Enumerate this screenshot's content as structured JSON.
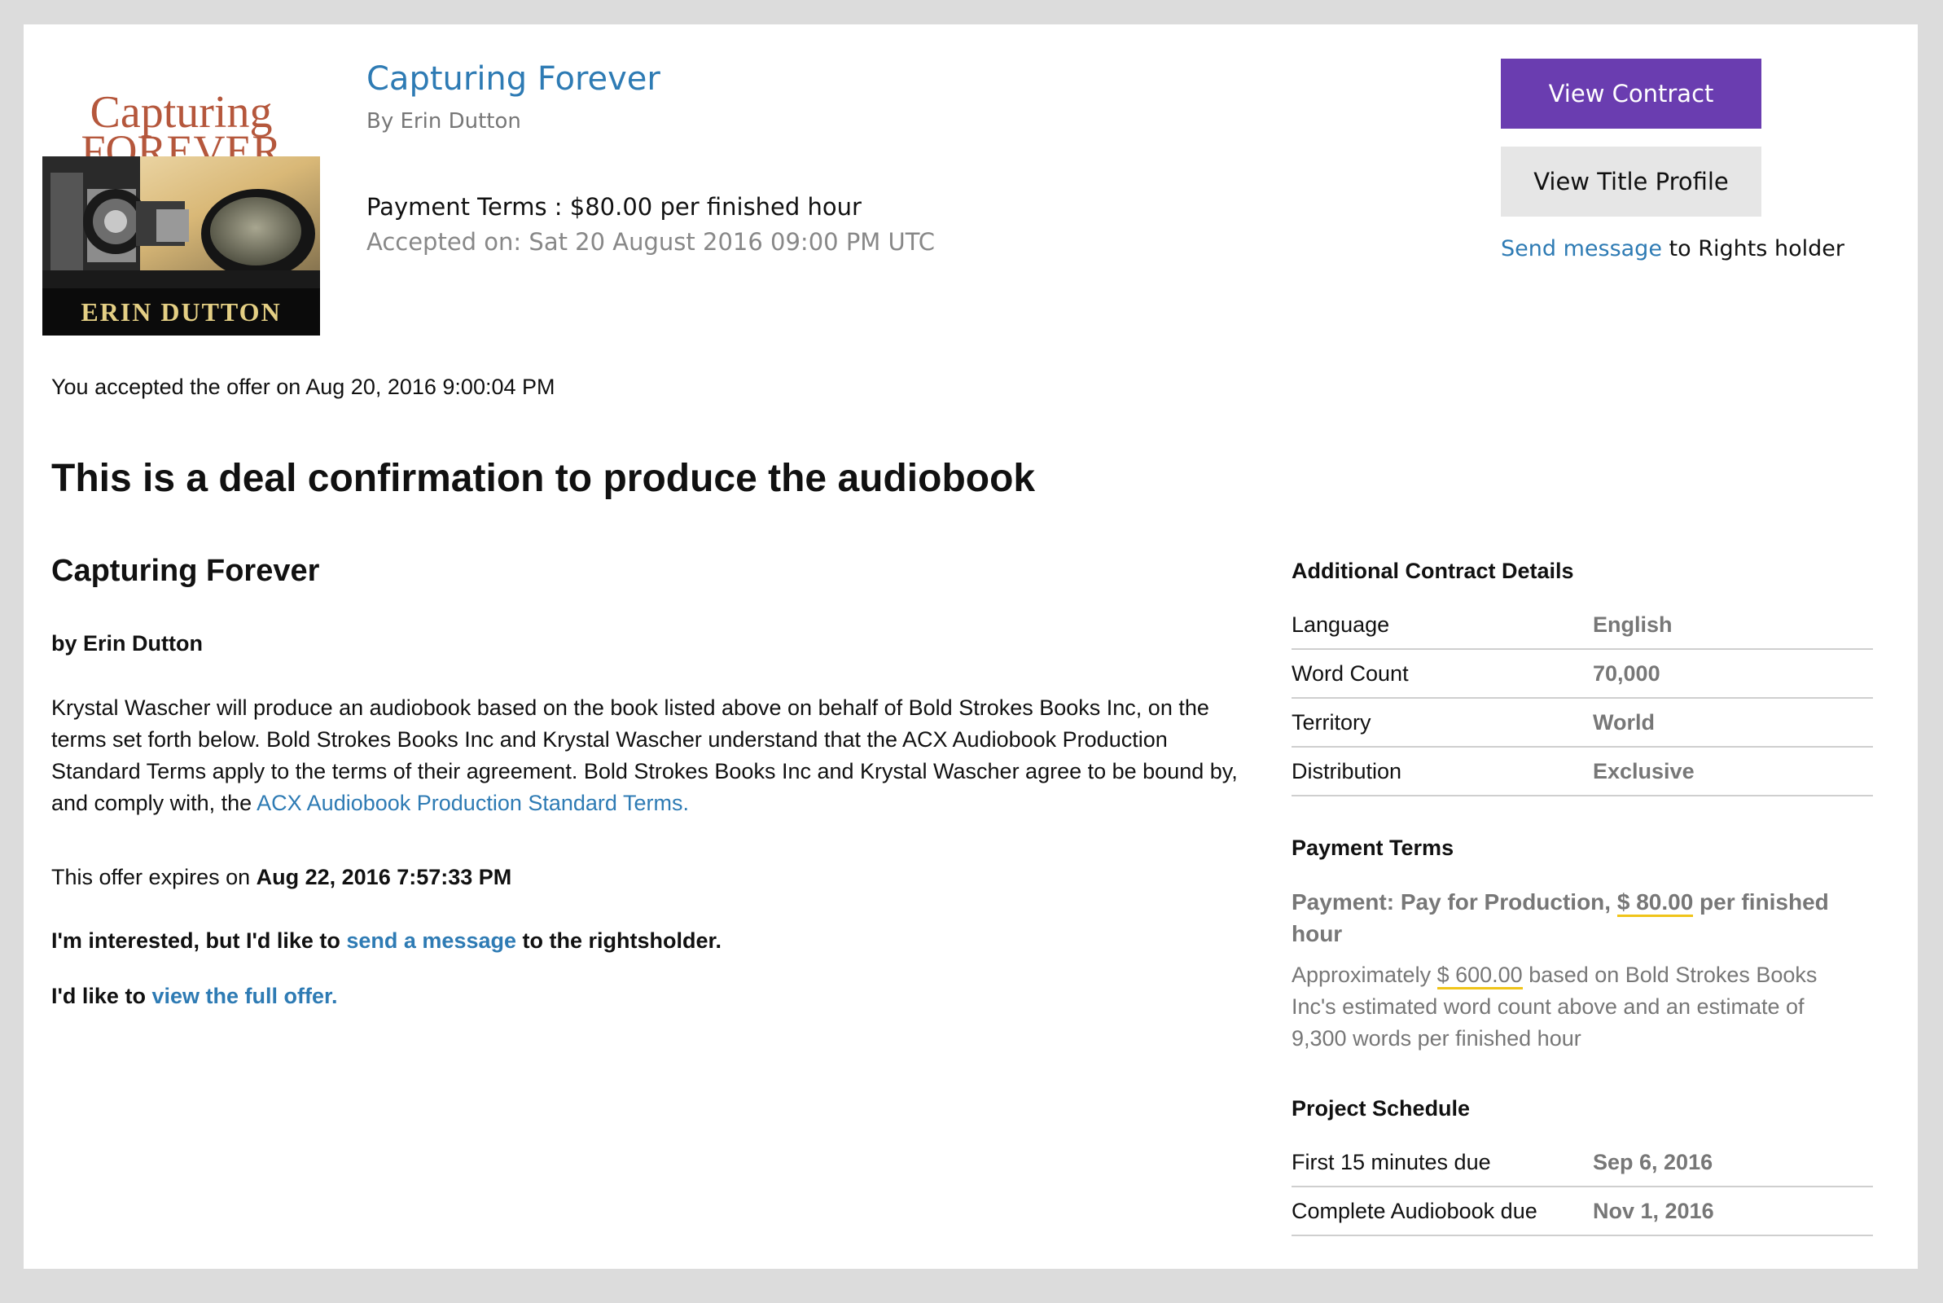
{
  "header": {
    "cover": {
      "title_line1": "Capturing",
      "title_line2": "FOREVER",
      "author": "ERIN DUTTON"
    },
    "book_title": "Capturing Forever",
    "byline": "By Erin Dutton",
    "payment_terms": "Payment Terms : $80.00 per finished hour",
    "accepted_on": "Accepted on: Sat 20 August 2016 09:00 PM UTC",
    "view_contract_label": "View Contract",
    "view_title_profile_label": "View Title Profile",
    "send_message_link": "Send message",
    "send_message_suffix": " to Rights holder"
  },
  "main": {
    "accepted_offer": "You accepted the offer on Aug 20, 2016 9:00:04 PM",
    "heading": "This is a deal confirmation to produce the audiobook",
    "title": "Capturing Forever",
    "by_author": "by Erin Dutton",
    "description": "Krystal Wascher will produce an audiobook based on the book listed above on behalf of Bold Strokes Books Inc, on the terms set forth below. Bold Strokes Books Inc and Krystal Wascher understand that the ACX Audiobook Production Standard Terms apply to the terms of their agreement. Bold Strokes Books Inc and Krystal Wascher agree to be bound by, and comply with, the ",
    "standard_terms_link": "ACX Audiobook Production Standard Terms.",
    "expires_prefix": "This offer expires on ",
    "expires_date": "Aug 22, 2016 7:57:33 PM",
    "interested_prefix": "I'm interested, but I'd like to ",
    "interested_link": "send a message",
    "interested_suffix": " to the rightsholder.",
    "full_offer_prefix": "I'd like to ",
    "full_offer_link": "view the full offer."
  },
  "details": {
    "heading": "Additional Contract Details",
    "rows": [
      {
        "label": "Language",
        "value": "English"
      },
      {
        "label": "Word Count",
        "value": "70,000"
      },
      {
        "label": "Territory",
        "value": "World"
      },
      {
        "label": "Distribution",
        "value": "Exclusive"
      }
    ]
  },
  "payment": {
    "heading": "Payment Terms",
    "line_prefix": "Payment: Pay for Production, ",
    "line_amount": "$ 80.00",
    "line_suffix": " per finished hour",
    "approx_prefix": "Approximately ",
    "approx_amount": "$ 600.00",
    "approx_suffix": " based on Bold Strokes Books Inc's estimated word count above and an estimate of 9,300 words per finished hour"
  },
  "schedule": {
    "heading": "Project Schedule",
    "rows": [
      {
        "label": "First 15 minutes due",
        "value": "Sep 6, 2016"
      },
      {
        "label": "Complete Audiobook due",
        "value": "Nov 1, 2016"
      }
    ]
  },
  "colors": {
    "link": "#2e7bb4",
    "primary_button": "#6a3db0",
    "secondary_button": "#e6e6e6",
    "highlight_underline": "#f0c419",
    "muted_text": "#777777"
  }
}
